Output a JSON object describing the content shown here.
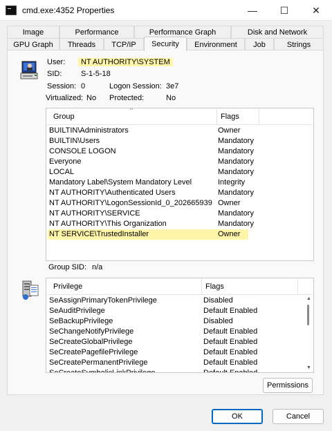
{
  "window": {
    "title": "cmd.exe:4352 Properties",
    "minimize_glyph": "—",
    "maximize_glyph": "☐",
    "close_glyph": "✕"
  },
  "tabs": {
    "row1": [
      "Image",
      "Performance",
      "Performance Graph",
      "Disk and Network"
    ],
    "row2": [
      "GPU Graph",
      "Threads",
      "TCP/IP",
      "Security",
      "Environment",
      "Job",
      "Strings"
    ],
    "active": "Security"
  },
  "security": {
    "user_label": "User:",
    "user_value": "NT AUTHORITY\\SYSTEM",
    "sid_label": "SID:",
    "sid_value": "S-1-5-18",
    "session_label": "Session:",
    "session_value": "0",
    "logon_session_label": "Logon Session:",
    "logon_session_value": "3e7",
    "virtualized_label": "Virtualized:",
    "virtualized_value": "No",
    "protected_label": "Protected:",
    "protected_value": "No",
    "group_sid_label": "Group SID:",
    "group_sid_value": "n/a"
  },
  "groups": {
    "columns": [
      "Group",
      "Flags"
    ],
    "rows": [
      [
        "BUILTIN\\Administrators",
        "Owner"
      ],
      [
        "BUILTIN\\Users",
        "Mandatory"
      ],
      [
        "CONSOLE LOGON",
        "Mandatory"
      ],
      [
        "Everyone",
        "Mandatory"
      ],
      [
        "LOCAL",
        "Mandatory"
      ],
      [
        "Mandatory Label\\System Mandatory Level",
        "Integrity"
      ],
      [
        "NT AUTHORITY\\Authenticated Users",
        "Mandatory"
      ],
      [
        "NT AUTHORITY\\LogonSessionId_0_202665939",
        "Owner"
      ],
      [
        "NT AUTHORITY\\SERVICE",
        "Mandatory"
      ],
      [
        "NT AUTHORITY\\This Organization",
        "Mandatory"
      ],
      [
        "NT SERVICE\\TrustedInstaller",
        "Owner"
      ]
    ],
    "highlighted_row": 10,
    "highlight_color": "#fff5a8"
  },
  "privileges": {
    "columns": [
      "Privilege",
      "Flags"
    ],
    "rows": [
      [
        "SeAssignPrimaryTokenPrivilege",
        "Disabled"
      ],
      [
        "SeAuditPrivilege",
        "Default Enabled"
      ],
      [
        "SeBackupPrivilege",
        "Disabled"
      ],
      [
        "SeChangeNotifyPrivilege",
        "Default Enabled"
      ],
      [
        "SeCreateGlobalPrivilege",
        "Default Enabled"
      ],
      [
        "SeCreatePagefilePrivilege",
        "Default Enabled"
      ],
      [
        "SeCreatePermanentPrivilege",
        "Default Enabled"
      ],
      [
        "SeCreateSymbolicLinkPrivilege",
        "Default Enabled"
      ]
    ]
  },
  "buttons": {
    "permissions": "Permissions",
    "ok": "OK",
    "cancel": "Cancel"
  },
  "icons": {
    "user": "user-computer-icon",
    "privilege": "privilege-server-icon"
  }
}
